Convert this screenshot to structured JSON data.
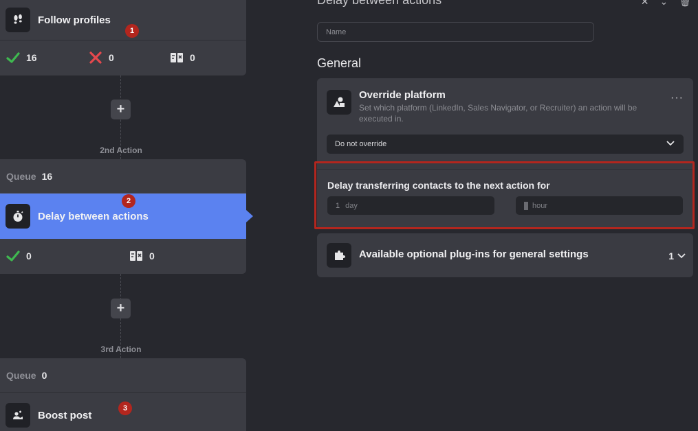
{
  "flow": {
    "action1": {
      "title": "Follow profiles",
      "badge": "1",
      "stats": {
        "success": "16",
        "failed": "0",
        "skipped": "0"
      }
    },
    "connector1": {
      "plus": "+",
      "label": "2nd Action"
    },
    "action2": {
      "queue_label": "Queue",
      "queue_value": "16",
      "title": "Delay between actions",
      "badge": "2",
      "stats": {
        "success": "0",
        "skipped": "0"
      }
    },
    "connector2": {
      "plus": "+",
      "label": "3rd Action"
    },
    "action3": {
      "queue_label": "Queue",
      "queue_value": "0",
      "title": "Boost post",
      "badge": "3"
    }
  },
  "panel": {
    "title": "Delay between actions",
    "name_placeholder": "Name",
    "section_title": "General",
    "override": {
      "title": "Override platform",
      "description": "Set which platform (LinkedIn, Sales Navigator, or Recruiter) an action will be executed in.",
      "menu": "···",
      "select_value": "Do not override"
    },
    "delay": {
      "title": "Delay transferring contacts to the next action for",
      "days_value": "1",
      "days_unit": "day",
      "hours_unit": "hour"
    },
    "plugins": {
      "title": "Available optional plug-ins for general settings",
      "count": "1"
    }
  },
  "colors": {
    "accent": "#5b82f0",
    "success": "#3fb950",
    "error": "#e5484d",
    "highlight": "#b3261e"
  }
}
